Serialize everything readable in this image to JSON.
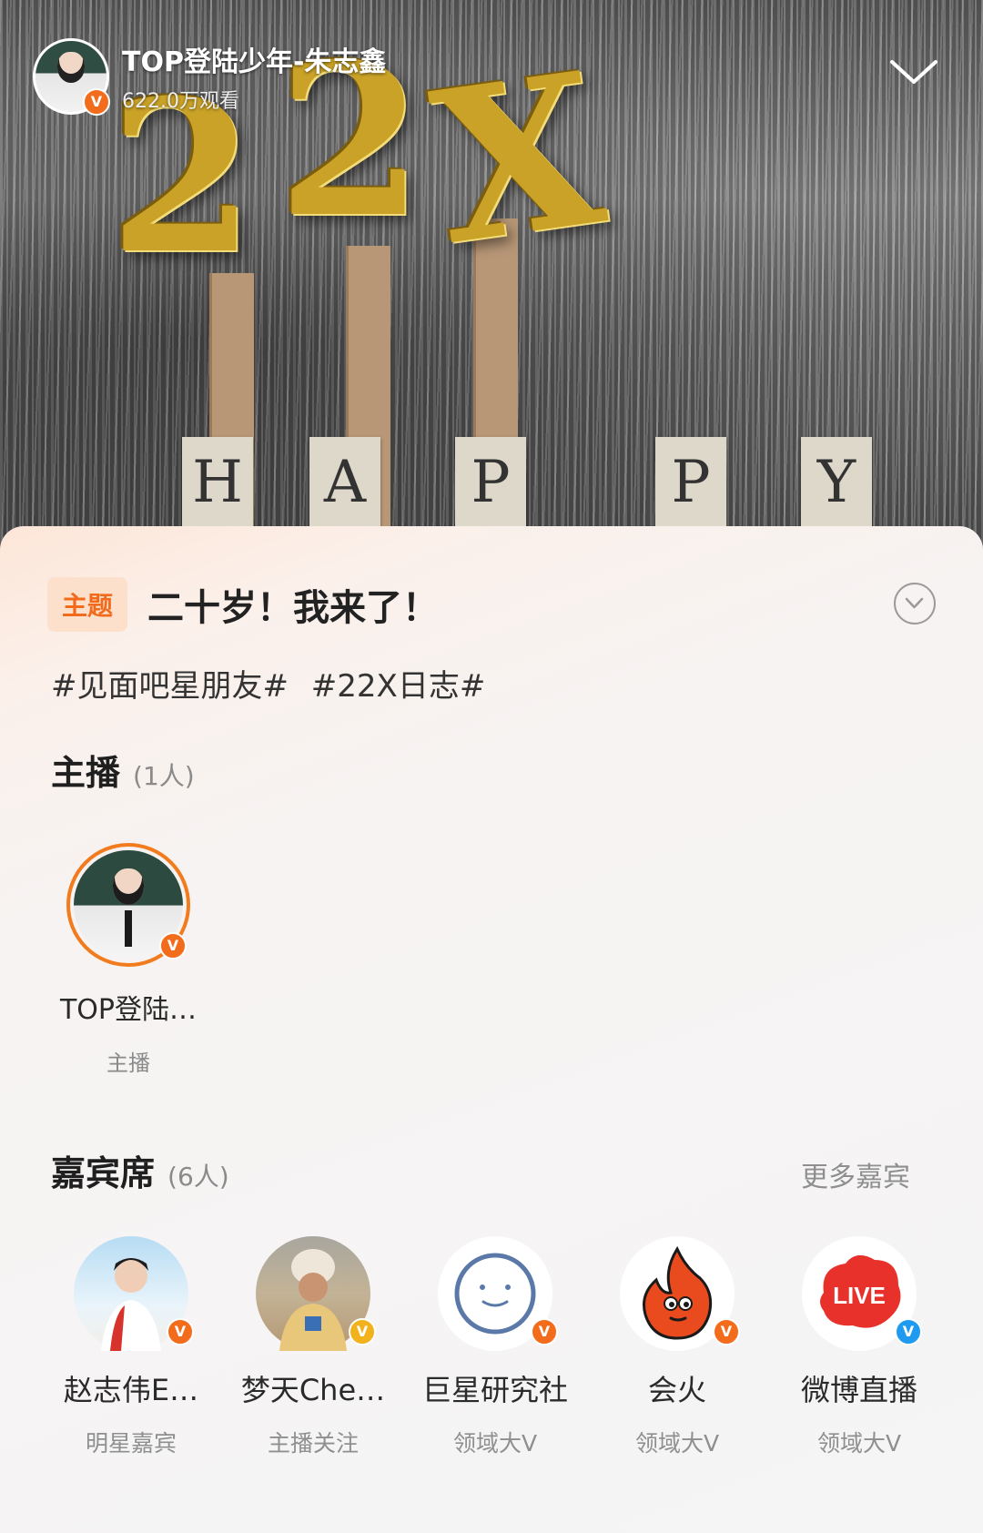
{
  "stream": {
    "title": "TOP登陆少年-朱志鑫",
    "viewers": "622.0万观看",
    "banner_letters": [
      "H",
      "A",
      "P",
      "P",
      "Y"
    ],
    "balloon_text": "22X"
  },
  "topic": {
    "tag": "主题",
    "title": "二十岁！我来了！",
    "hashtags": [
      "#见面吧星朋友#",
      "#22X日志#"
    ]
  },
  "host_section": {
    "heading": "主播",
    "count": "(1人)",
    "host": {
      "name": "TOP登陆…",
      "role": "主播",
      "badge_color": "#f36c1b"
    }
  },
  "guest_section": {
    "heading": "嘉宾席",
    "count": "(6人)",
    "more_label": "更多嘉宾",
    "guests": [
      {
        "name": "赵志伟E…",
        "role": "明星嘉宾",
        "badge_color": "#f36c1b"
      },
      {
        "name": "梦天Che…",
        "role": "主播关注",
        "badge_color": "#f2b21b"
      },
      {
        "name": "巨星研究社",
        "role": "领域大V",
        "badge_color": "#f36c1b"
      },
      {
        "name": "会火",
        "role": "领域大V",
        "badge_color": "#f36c1b"
      },
      {
        "name": "微博直播",
        "role": "领域大V",
        "badge_color": "#1e9bf0"
      }
    ]
  },
  "icons": {
    "verified_badge": "V",
    "live_logo": "LIVE"
  },
  "colors": {
    "accent": "#f26b1d",
    "tag_bg": "#fde0cc",
    "verified_blue": "#1e9bf0"
  }
}
